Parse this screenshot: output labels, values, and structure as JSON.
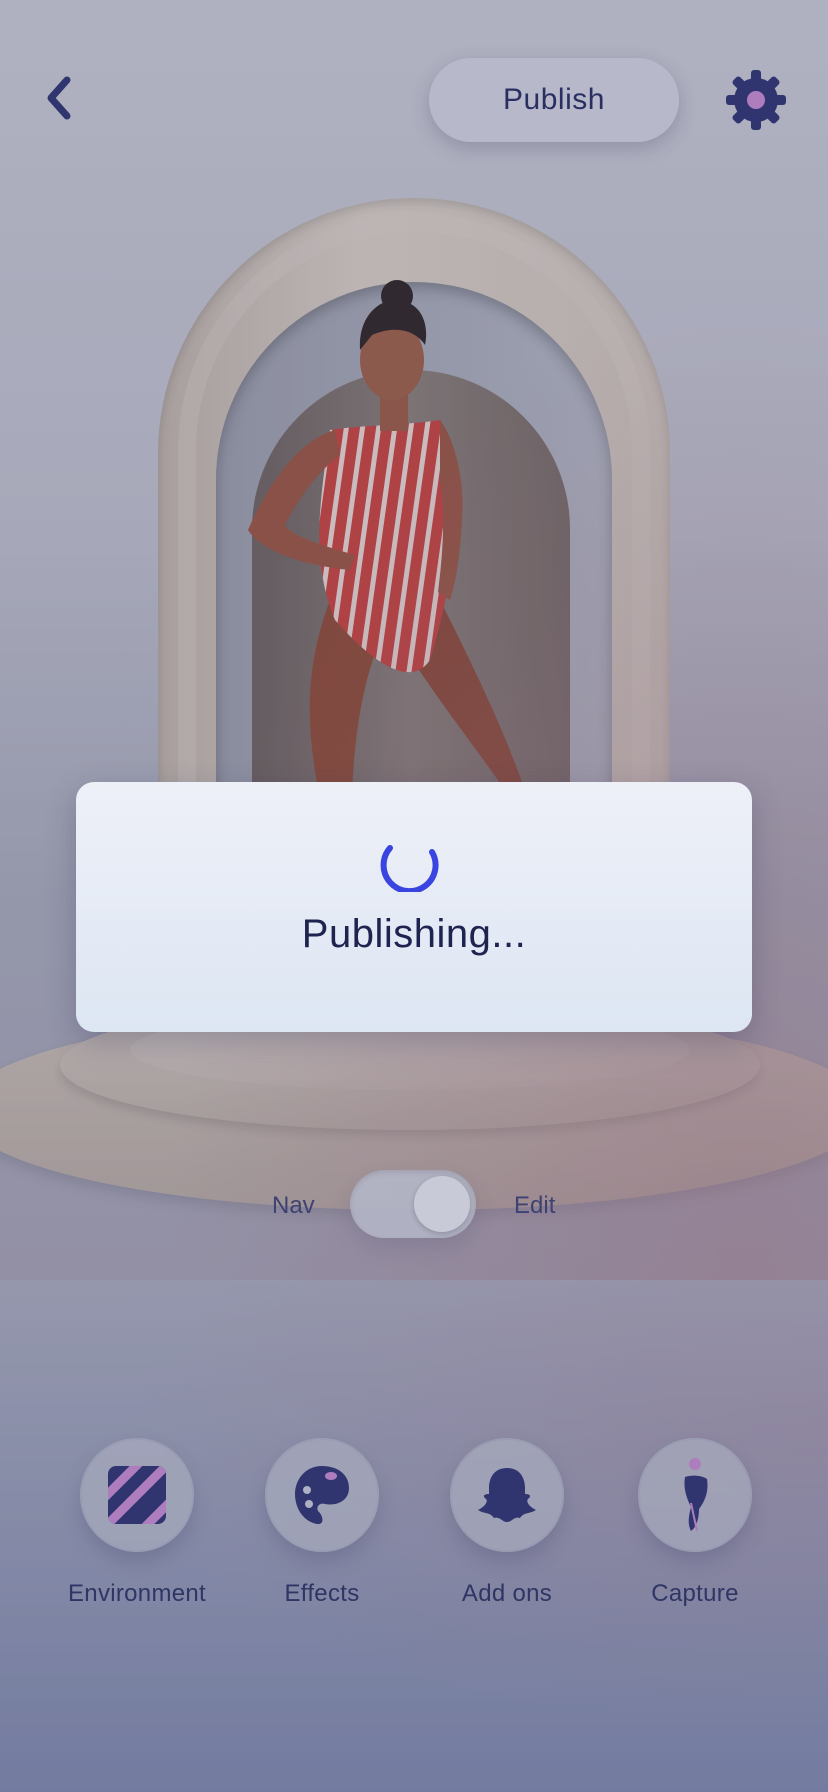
{
  "header": {
    "back_icon": "chevron-left-icon",
    "publish_label": "Publish",
    "settings_icon": "gear-icon"
  },
  "toggle": {
    "left_label": "Nav",
    "right_label": "Edit",
    "state": "edit"
  },
  "toolbar": {
    "items": [
      {
        "label": "Environment",
        "icon": "environment-stripes-icon"
      },
      {
        "label": "Effects",
        "icon": "palette-icon"
      },
      {
        "label": "Add ons",
        "icon": "ghost-icon"
      },
      {
        "label": "Capture",
        "icon": "person-capture-icon"
      }
    ]
  },
  "modal": {
    "message": "Publishing..."
  },
  "colors": {
    "accent": "#2f3370",
    "spinner": "#3a44e0",
    "highlight": "#c68ad0"
  }
}
